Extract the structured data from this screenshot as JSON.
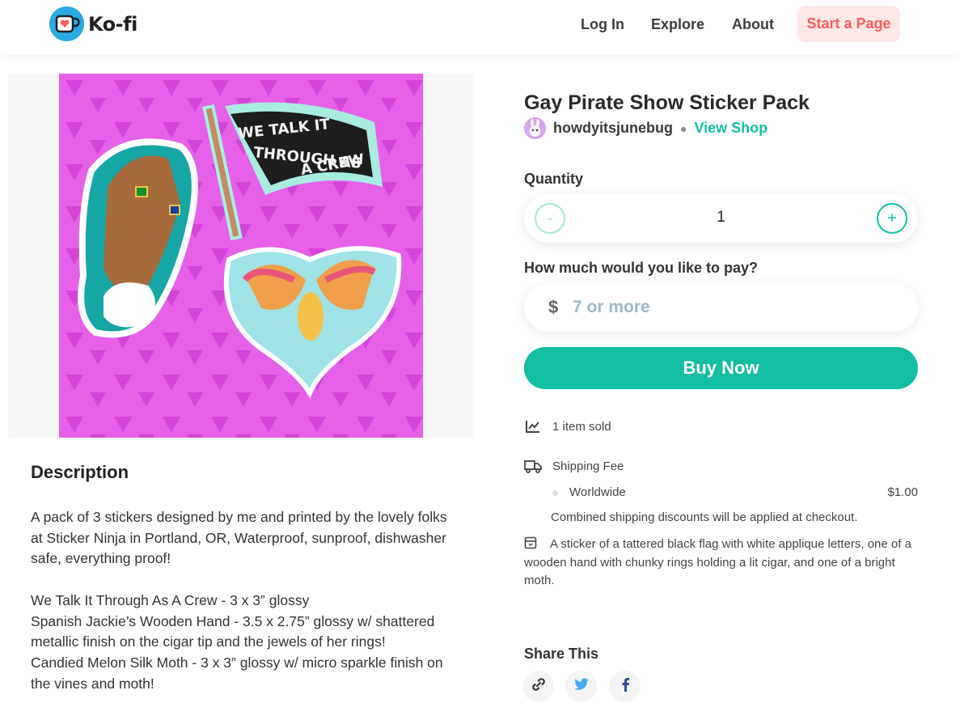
{
  "header": {
    "logo_text": "Ko-fi",
    "nav": [
      "Log In",
      "Explore",
      "About"
    ],
    "cta": "Start a Page"
  },
  "product": {
    "title": "Gay Pirate Show Sticker Pack",
    "seller": "howdyitsjunebug",
    "view_shop": "View Shop",
    "flag_text": [
      "WE TALK IT",
      "THROUGH AS",
      "A CREW"
    ]
  },
  "purchase": {
    "quantity_label": "Quantity",
    "quantity_minus": "-",
    "quantity_plus": "+",
    "quantity_value": "1",
    "pay_label": "How much would you like to pay?",
    "currency": "$",
    "pay_placeholder": "7 or more",
    "buy_label": "Buy Now"
  },
  "info": {
    "sold": "1 item sold",
    "shipping_label": "Shipping Fee",
    "shipping_region": "Worldwide",
    "shipping_price": "$1.00",
    "shipping_note": "Combined shipping discounts will be applied at checkout.",
    "package_desc": "A sticker of a tattered black flag with white applique letters, one of a wooden hand with chunky rings holding a lit cigar, and one of a bright moth."
  },
  "description": {
    "title": "Description",
    "paragraphs": [
      "A pack of 3 stickers designed by me and printed by the lovely folks at Sticker Ninja in Portland, OR, Waterproof, sunproof, dishwasher safe, everything proof!",
      "We Talk It Through As A Crew - 3 x 3” glossy\nSpanish Jackie’s Wooden Hand - 3.5 x 2.75” glossy w/ shattered metallic finish on the cigar tip and the jewels of her rings!\nCandied Melon Silk Moth - 3 x 3” glossy w/ micro sparkle finish on the vines and moth!"
    ]
  },
  "share": {
    "title": "Share This",
    "icons": [
      "link-icon",
      "twitter-icon",
      "facebook-icon"
    ]
  },
  "colors": {
    "accent": "#13bfa0",
    "cta_bg": "#fde8e8",
    "cta_text": "#ff5e5b",
    "image_bg": "#e661e8"
  }
}
